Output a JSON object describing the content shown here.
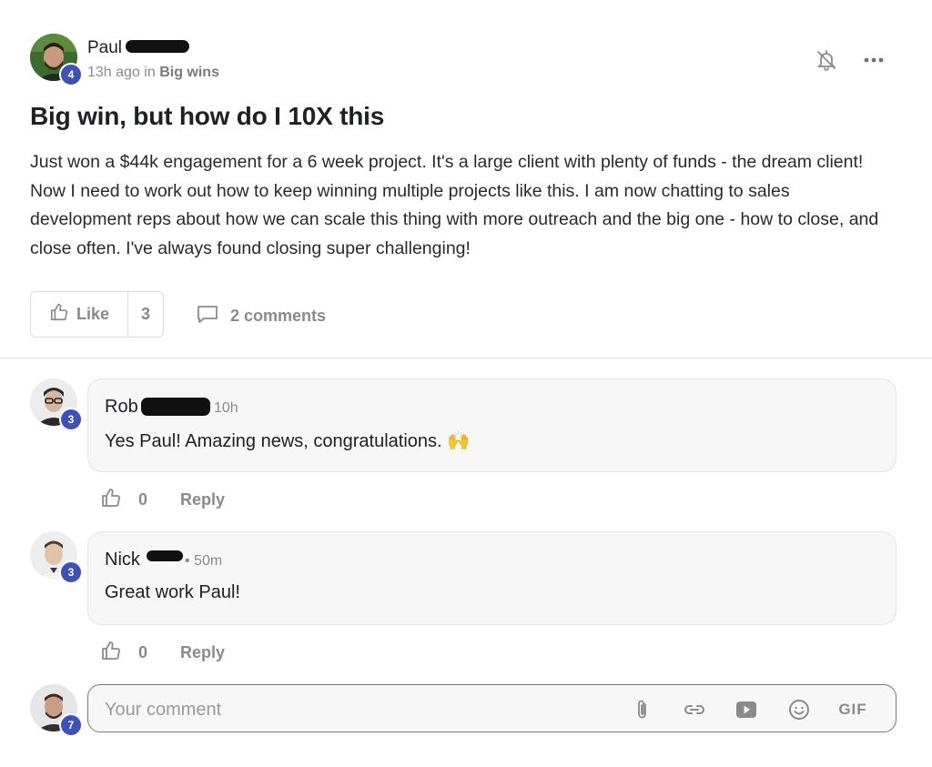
{
  "post": {
    "author": {
      "first_name": "Paul",
      "level": "4"
    },
    "time": "13h ago in",
    "category": "Big wins",
    "title": "Big win, but how do I 10X this",
    "body": "Just won a $44k engagement for a 6 week project. It's a large client with plenty of funds - the dream client! Now I need to work out how to keep winning multiple projects like this. I am now chatting to sales development reps about how we can scale this thing with more outreach and the big one - how to close, and close often. I've always found closing super challenging!",
    "like_label": "Like",
    "like_count": "3",
    "comments_label": "2 comments"
  },
  "comments": [
    {
      "name": "Rob",
      "level": "3",
      "time": "10h",
      "text": "Yes Paul! Amazing news, congratulations. 🙌",
      "like_count": "0",
      "reply_label": "Reply"
    },
    {
      "name": "Nick",
      "level": "3",
      "time": "• 50m",
      "text": "Great work Paul!",
      "like_count": "0",
      "reply_label": "Reply"
    }
  ],
  "composer": {
    "level": "7",
    "placeholder": "Your comment",
    "gif_label": "GIF"
  },
  "colors": {
    "level_badge": "#3f51b5",
    "muted": "#8a8a8a",
    "card_bg": "#f7f7f7"
  },
  "icons": [
    "bell-off-icon",
    "more-icon",
    "thumbs-up-icon",
    "comment-icon",
    "paperclip-icon",
    "link-icon",
    "video-icon",
    "emoji-icon",
    "gif-icon"
  ]
}
